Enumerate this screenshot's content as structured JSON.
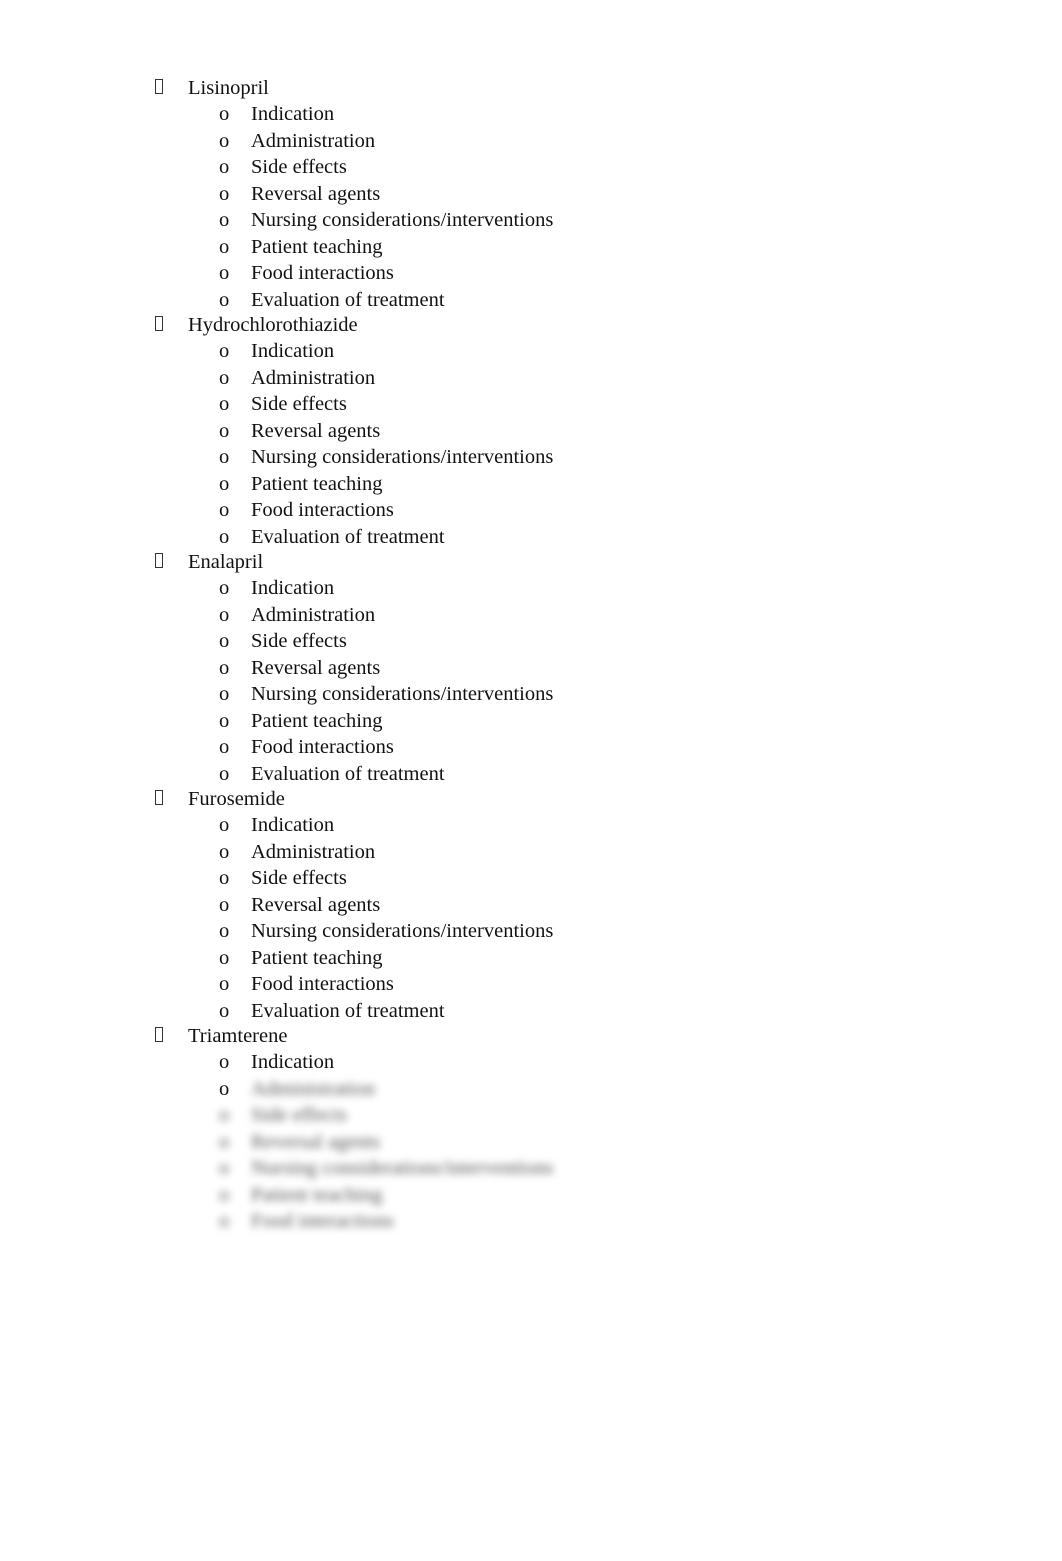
{
  "document": {
    "bullet_level1_icon": "missing-glyph-box",
    "bullet_level2": "o",
    "drugs": [
      {
        "name": "Lisinopril",
        "items": [
          "Indication",
          "Administration",
          "Side effects",
          "Reversal agents",
          "Nursing considerations/interventions",
          "Patient teaching",
          "Food interactions",
          "Evaluation of treatment"
        ]
      },
      {
        "name": "Hydrochlorothiazide",
        "items": [
          "Indication",
          "Administration",
          "Side effects",
          "Reversal agents",
          "Nursing considerations/interventions",
          "Patient teaching",
          "Food interactions",
          "Evaluation of treatment"
        ]
      },
      {
        "name": "Enalapril",
        "items": [
          "Indication",
          "Administration",
          "Side effects",
          "Reversal agents",
          "Nursing considerations/interventions",
          "Patient teaching",
          "Food interactions",
          "Evaluation of treatment"
        ]
      },
      {
        "name": "Furosemide",
        "items": [
          "Indication",
          "Administration",
          "Side effects",
          "Reversal agents",
          "Nursing considerations/interventions",
          "Patient teaching",
          "Food interactions",
          "Evaluation of treatment"
        ]
      },
      {
        "name": "Triamterene",
        "items": [
          "Indication"
        ],
        "blurred_items": [
          "Administration",
          "Side effects",
          "Reversal agents",
          "Nursing considerations/interventions",
          "Patient teaching",
          "Food interactions"
        ]
      }
    ]
  }
}
